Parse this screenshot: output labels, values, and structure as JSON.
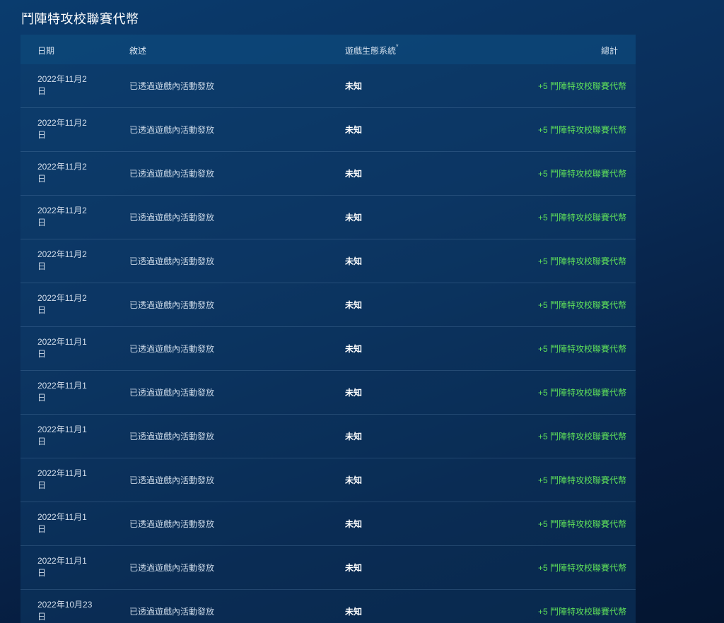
{
  "page": {
    "title": "鬥陣特攻校聯賽代幣"
  },
  "table": {
    "headers": {
      "date": "日期",
      "description": "敘述",
      "ecosystem": "遊戲生態系統",
      "ecosystem_marker": "*",
      "total": "總計"
    },
    "rows": [
      {
        "date_line1": "2022年11月2",
        "date_line2": "日",
        "description": "已透過遊戲內活動發放",
        "ecosystem": "未知",
        "total": "+5 鬥陣特攻校聯賽代幣"
      },
      {
        "date_line1": "2022年11月2",
        "date_line2": "日",
        "description": "已透過遊戲內活動發放",
        "ecosystem": "未知",
        "total": "+5 鬥陣特攻校聯賽代幣"
      },
      {
        "date_line1": "2022年11月2",
        "date_line2": "日",
        "description": "已透過遊戲內活動發放",
        "ecosystem": "未知",
        "total": "+5 鬥陣特攻校聯賽代幣"
      },
      {
        "date_line1": "2022年11月2",
        "date_line2": "日",
        "description": "已透過遊戲內活動發放",
        "ecosystem": "未知",
        "total": "+5 鬥陣特攻校聯賽代幣"
      },
      {
        "date_line1": "2022年11月2",
        "date_line2": "日",
        "description": "已透過遊戲內活動發放",
        "ecosystem": "未知",
        "total": "+5 鬥陣特攻校聯賽代幣"
      },
      {
        "date_line1": "2022年11月2",
        "date_line2": "日",
        "description": "已透過遊戲內活動發放",
        "ecosystem": "未知",
        "total": "+5 鬥陣特攻校聯賽代幣"
      },
      {
        "date_line1": "2022年11月1",
        "date_line2": "日",
        "description": "已透過遊戲內活動發放",
        "ecosystem": "未知",
        "total": "+5 鬥陣特攻校聯賽代幣"
      },
      {
        "date_line1": "2022年11月1",
        "date_line2": "日",
        "description": "已透過遊戲內活動發放",
        "ecosystem": "未知",
        "total": "+5 鬥陣特攻校聯賽代幣"
      },
      {
        "date_line1": "2022年11月1",
        "date_line2": "日",
        "description": "已透過遊戲內活動發放",
        "ecosystem": "未知",
        "total": "+5 鬥陣特攻校聯賽代幣"
      },
      {
        "date_line1": "2022年11月1",
        "date_line2": "日",
        "description": "已透過遊戲內活動發放",
        "ecosystem": "未知",
        "total": "+5 鬥陣特攻校聯賽代幣"
      },
      {
        "date_line1": "2022年11月1",
        "date_line2": "日",
        "description": "已透過遊戲內活動發放",
        "ecosystem": "未知",
        "total": "+5 鬥陣特攻校聯賽代幣"
      },
      {
        "date_line1": "2022年11月1",
        "date_line2": "日",
        "description": "已透過遊戲內活動發放",
        "ecosystem": "未知",
        "total": "+5 鬥陣特攻校聯賽代幣"
      },
      {
        "date_line1": "2022年10月23",
        "date_line2": "日",
        "description": "已透過遊戲內活動發放",
        "ecosystem": "未知",
        "total": "+5 鬥陣特攻校聯賽代幣"
      }
    ]
  },
  "colors": {
    "total_text": "#5fe05a",
    "background": "#0a2e5a"
  }
}
